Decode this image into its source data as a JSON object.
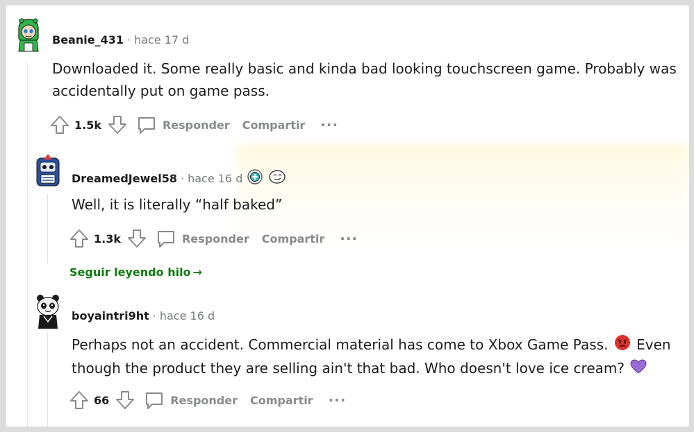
{
  "comments": [
    {
      "username": "Beanie_431",
      "separator": "·",
      "time": "hace 17 d",
      "body": "Downloaded it. Some really basic and kinda bad looking touchscreen game. Probably was accidentally put on game pass.",
      "score": "1.5k",
      "reply_label": "Responder",
      "share_label": "Compartir",
      "more_label": "···",
      "avatar_icon": "green-hood-avatar"
    },
    {
      "username": "DreamedJewel58",
      "separator": "·",
      "time": "hace 16 d",
      "body": "Well, it is literally “half baked”",
      "score": "1.3k",
      "reply_label": "Responder",
      "share_label": "Compartir",
      "more_label": "···",
      "avatar_icon": "robot-avatar",
      "flairs": [
        "teal-badge-icon",
        "smiley-face-icon"
      ]
    },
    {
      "username": "boyaintri9ht",
      "separator": "·",
      "time": "hace 16 d",
      "body_part1": "Perhaps not an accident. Commercial material has come to Xbox Game Pass. ",
      "body_part2": " Even though the product they are selling ain't that bad. Who doesn't love ice cream? ",
      "score": "66",
      "reply_label": "Responder",
      "share_label": "Compartir",
      "more_label": "···",
      "avatar_icon": "panda-avatar",
      "emojis": [
        "angry-face-icon",
        "purple-heart-icon"
      ]
    }
  ],
  "continue_thread": {
    "label": "Seguir leyendo hilo",
    "arrow": "→"
  },
  "colors": {
    "text": "#1c1c1c",
    "muted": "#878a8c",
    "link_green": "#0f7a0f",
    "thread_line": "#e4e4e4"
  }
}
